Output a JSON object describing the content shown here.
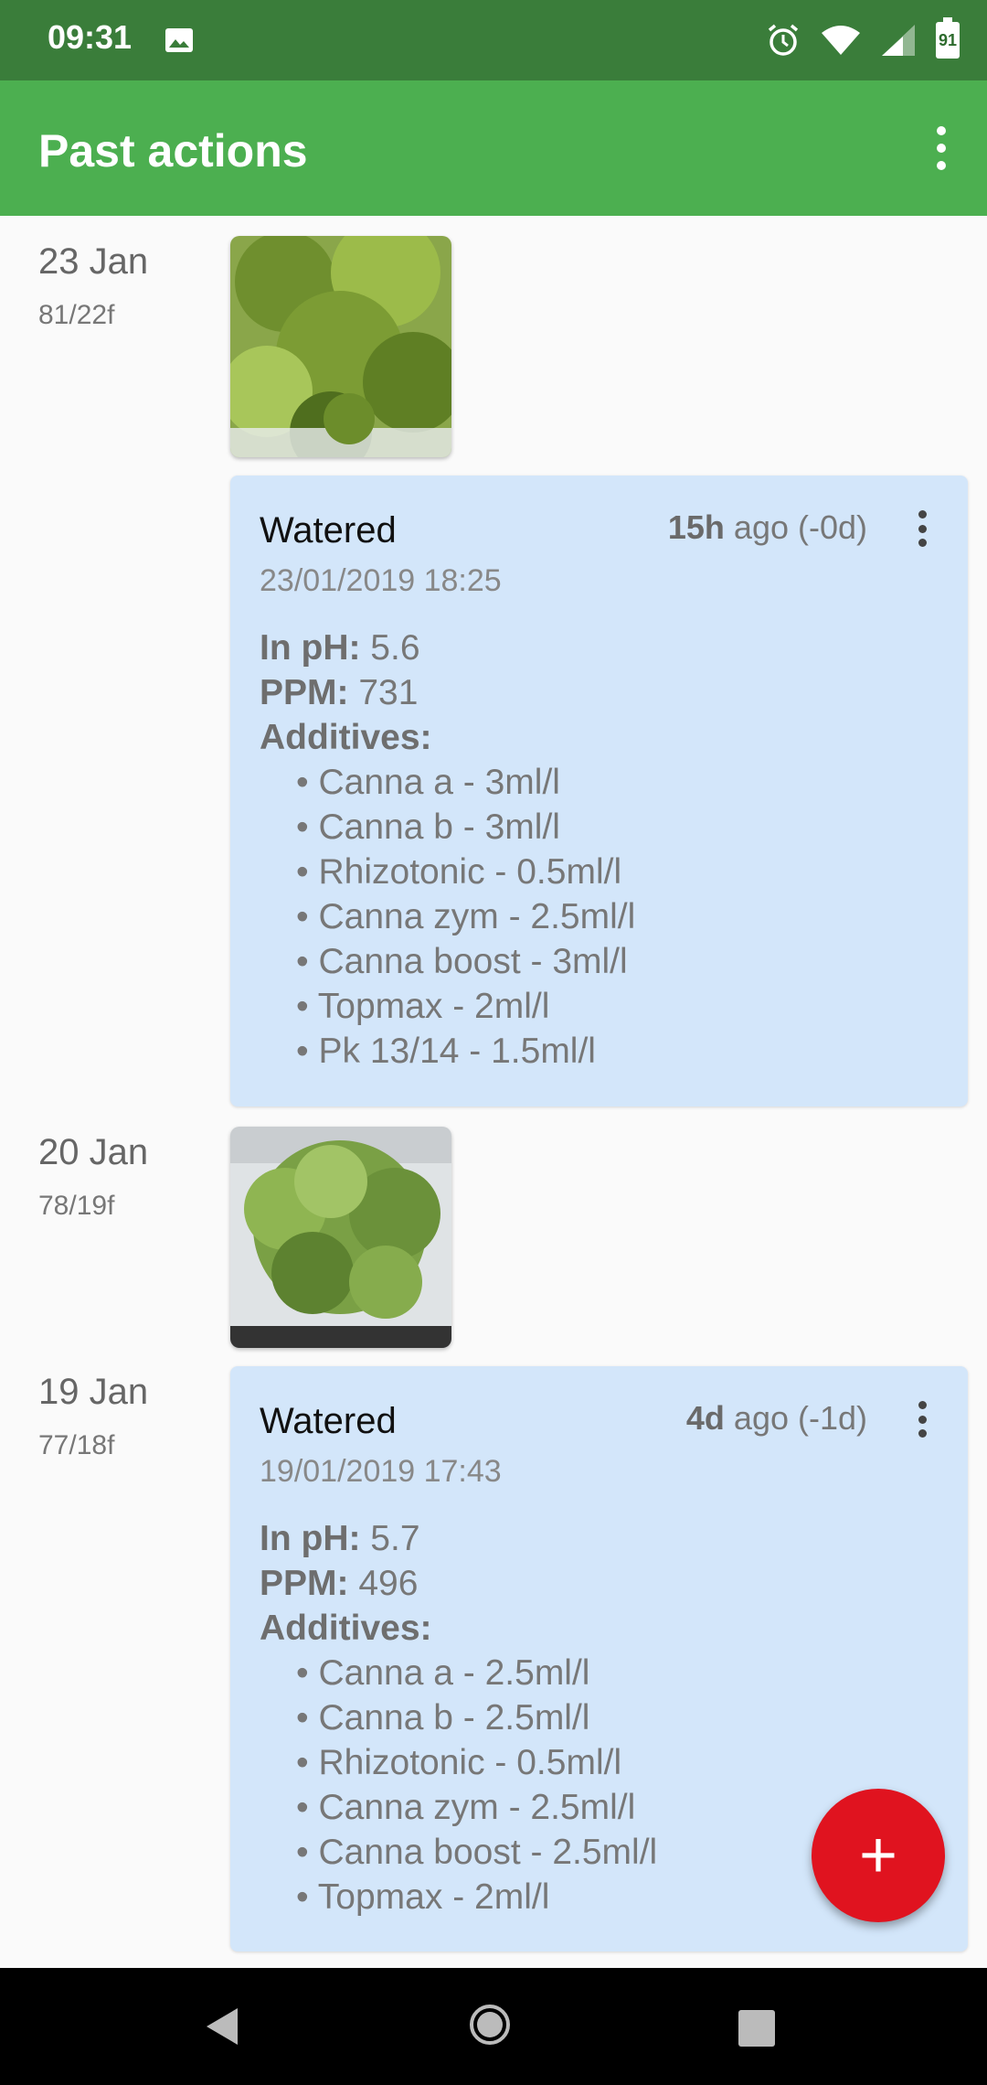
{
  "status_bar": {
    "time": "09:31",
    "battery": "91"
  },
  "app_bar": {
    "title": "Past actions"
  },
  "entries": [
    {
      "date": "23 Jan",
      "sub": "81/22f"
    },
    {
      "date": "20 Jan",
      "sub": "78/19f"
    },
    {
      "date": "19 Jan",
      "sub": "77/18f"
    }
  ],
  "cards": [
    {
      "action": "Watered",
      "ago_bold": "15h",
      "ago_rest": " ago (-0d)",
      "datetime": "23/01/2019 18:25",
      "ph_label": "In pH:",
      "ph": " 5.6",
      "ppm_label": "PPM:",
      "ppm": " 731",
      "additives_label": "Additives:",
      "additives": [
        "Canna a - 3ml/l",
        "Canna b - 3ml/l",
        "Rhizotonic - 0.5ml/l",
        "Canna zym - 2.5ml/l",
        "Canna boost - 3ml/l",
        "Topmax - 2ml/l",
        "Pk 13/14 - 1.5ml/l"
      ]
    },
    {
      "action": "Watered",
      "ago_bold": "4d",
      "ago_rest": " ago (-1d)",
      "datetime": "19/01/2019 17:43",
      "ph_label": "In pH:",
      "ph": " 5.7",
      "ppm_label": "PPM:",
      "ppm": " 496",
      "additives_label": "Additives:",
      "additives": [
        "Canna a - 2.5ml/l",
        "Canna b - 2.5ml/l",
        "Rhizotonic - 0.5ml/l",
        "Canna zym - 2.5ml/l",
        "Canna boost - 2.5ml/l",
        "Topmax - 2ml/l"
      ]
    }
  ],
  "fab": {
    "icon": "plus-icon",
    "label": "+"
  },
  "colors": {
    "status_bar": "#3a7d3a",
    "app_bar": "#4caf50",
    "card": "#d3e6fa",
    "fab": "#e0131f"
  }
}
